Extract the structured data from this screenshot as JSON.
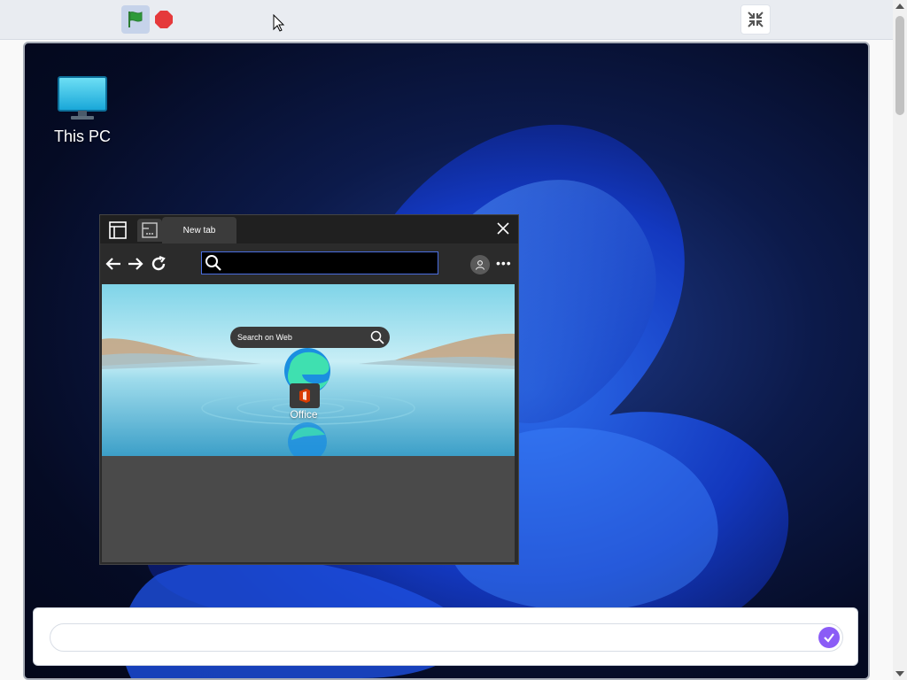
{
  "toolbar": {
    "green_flag_icon": "green-flag-icon",
    "stop_icon": "stop-icon",
    "fullscreen_icon": "exit-fullscreen-icon",
    "colors": {
      "flag": "#2e9a3a",
      "stop": "#e5393b",
      "flag_bg": "#c6d3ea"
    }
  },
  "desktop": {
    "icons": [
      {
        "label": "This PC",
        "icon": "monitor-icon"
      }
    ]
  },
  "browser": {
    "tabs": [
      {
        "label": "New tab"
      }
    ],
    "address_value": "",
    "newtab": {
      "search_placeholder": "Search on Web",
      "shortcuts": [
        {
          "label": "Office",
          "icon": "office-icon"
        }
      ]
    }
  },
  "answer_bar": {
    "value": "",
    "placeholder": "",
    "submit_color": "#8b5cf6"
  }
}
